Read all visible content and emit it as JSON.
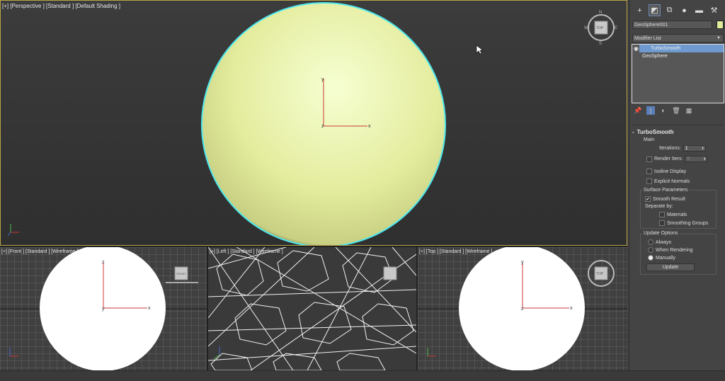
{
  "viewports": {
    "perspective": {
      "label": "[+] [Perspective ] [Standard ] [Default Shading ]"
    },
    "front": {
      "label": "[+] [Front ] [Standard ] [Wireframe ]"
    },
    "left": {
      "label": "[+] [Left ] [Standard ] [Wireframe ]"
    },
    "top": {
      "label": "[+] [Top ] [Standard ] [Wireframe ]"
    }
  },
  "axes": {
    "x": "x",
    "y": "y",
    "z": "z"
  },
  "viewcube": {
    "top": "TOP",
    "front": "FRONT",
    "n": "N",
    "s": "S",
    "e": "E",
    "w": "W"
  },
  "command_panel": {
    "tabs": [
      {
        "icon": "create-icon",
        "glyph": "+"
      },
      {
        "icon": "modify-icon",
        "glyph": "◩"
      },
      {
        "icon": "hierarchy-icon",
        "glyph": "⧉"
      },
      {
        "icon": "motion-icon",
        "glyph": "●"
      },
      {
        "icon": "display-icon",
        "glyph": "▬"
      },
      {
        "icon": "utilities-icon",
        "glyph": "🔧"
      }
    ],
    "object_name": "GeoSphere001",
    "object_color": "#e0ec9c",
    "modifier_list": "Modifier List",
    "stack": [
      {
        "name": "TurboSmooth",
        "selected": true
      },
      {
        "name": "GeoSphere",
        "selected": false
      }
    ],
    "rollout_title": "TurboSmooth",
    "main": {
      "label": "Main",
      "iterations_label": "Iterations:",
      "iterations_value": "1",
      "render_iters_label": "Render Iters:",
      "render_iters_value": "0",
      "isoline_display": "Isoline Display",
      "explicit_normals": "Explicit Normals"
    },
    "surface": {
      "label": "Surface Parameters",
      "smooth_result": "Smooth Result",
      "separate_by": "Separate by:",
      "materials": "Materials",
      "smoothing_groups": "Smoothing Groups"
    },
    "update": {
      "label": "Update Options",
      "always": "Always",
      "when_rendering": "When Rendering",
      "manually": "Manually",
      "button": "Update"
    }
  }
}
